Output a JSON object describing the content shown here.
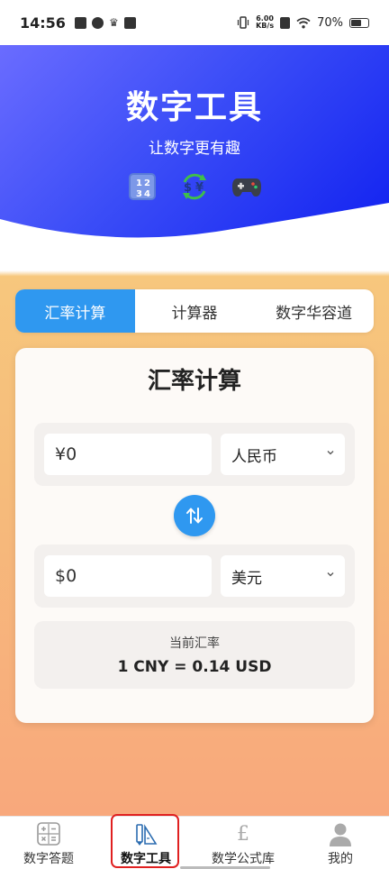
{
  "status": {
    "time": "14:56",
    "net_speed_value": "6.00",
    "net_speed_unit": "KB/s",
    "battery": "70%",
    "battery_level": 0.7
  },
  "hero": {
    "title": "数字工具",
    "subtitle": "让数字更有趣",
    "emojis": [
      "numbers-icon",
      "currency-exchange-icon",
      "gamepad-icon"
    ],
    "gradient": [
      "#6a6cff",
      "#1020f0"
    ]
  },
  "tabs": [
    {
      "label": "汇率计算",
      "active": true
    },
    {
      "label": "计算器",
      "active": false
    },
    {
      "label": "数字华容道",
      "active": false
    }
  ],
  "card": {
    "title": "汇率计算",
    "from": {
      "symbol": "¥",
      "amount": "0",
      "currency": "人民币"
    },
    "to": {
      "symbol": "$",
      "amount": "0",
      "currency": "美元"
    },
    "rate_label": "当前汇率",
    "rate_value": "1 CNY = 0.14 USD"
  },
  "nav": [
    {
      "label": "数字答题",
      "icon": "calculator-icon",
      "active": false
    },
    {
      "label": "数字工具",
      "icon": "pencil-ruler-icon",
      "active": true
    },
    {
      "label": "数学公式库",
      "icon": "pound-icon",
      "active": false
    },
    {
      "label": "我的",
      "icon": "user-icon",
      "active": false
    }
  ],
  "colors": {
    "accent": "#2f98f0",
    "highlight": "#e02020"
  }
}
